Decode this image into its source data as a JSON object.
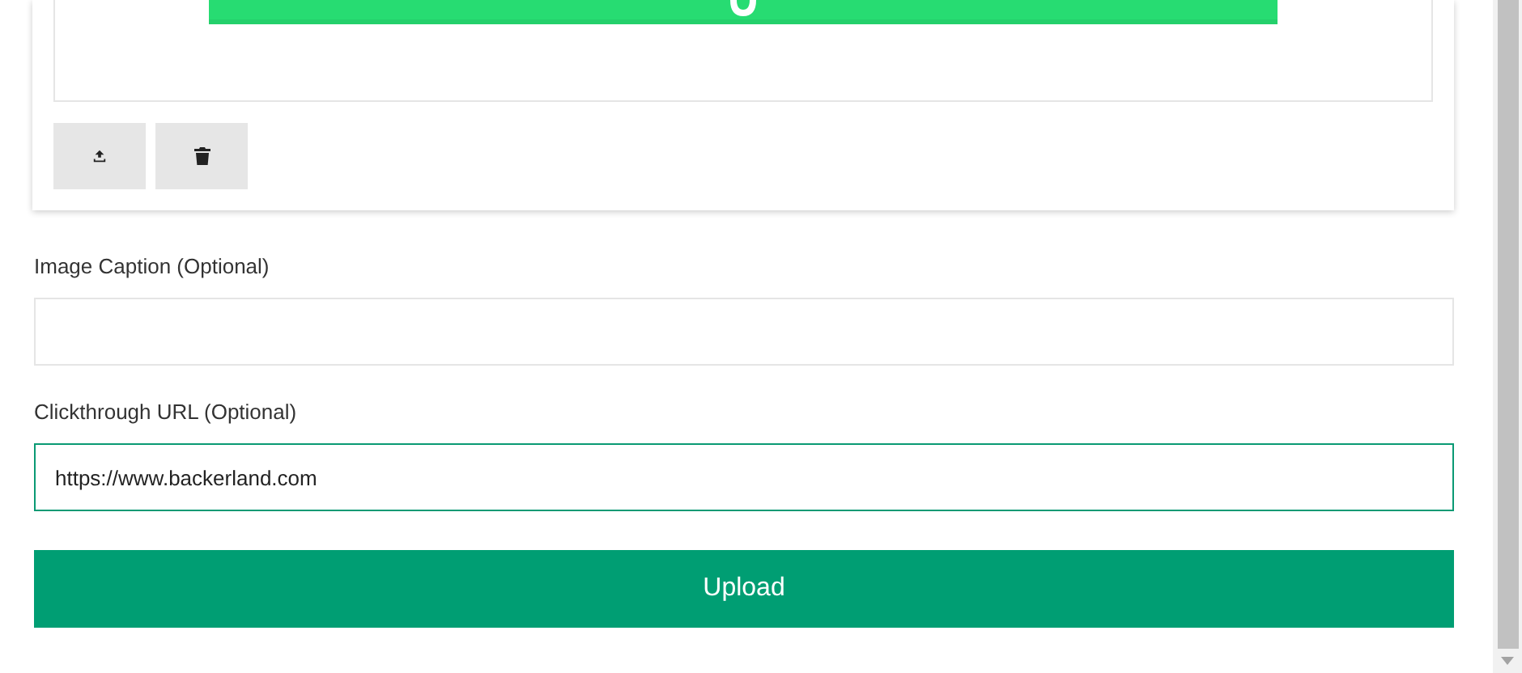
{
  "image_buttons": [
    {
      "kind": "upload"
    },
    {
      "kind": "delete"
    }
  ],
  "caption_field": {
    "label": "Image Caption (Optional)"
  },
  "url_field": {
    "label": "Clickthrough URL (Optional)",
    "value": "https://www.backerland.com",
    "focused": true
  },
  "submit_button": {
    "label": "Upload"
  }
}
